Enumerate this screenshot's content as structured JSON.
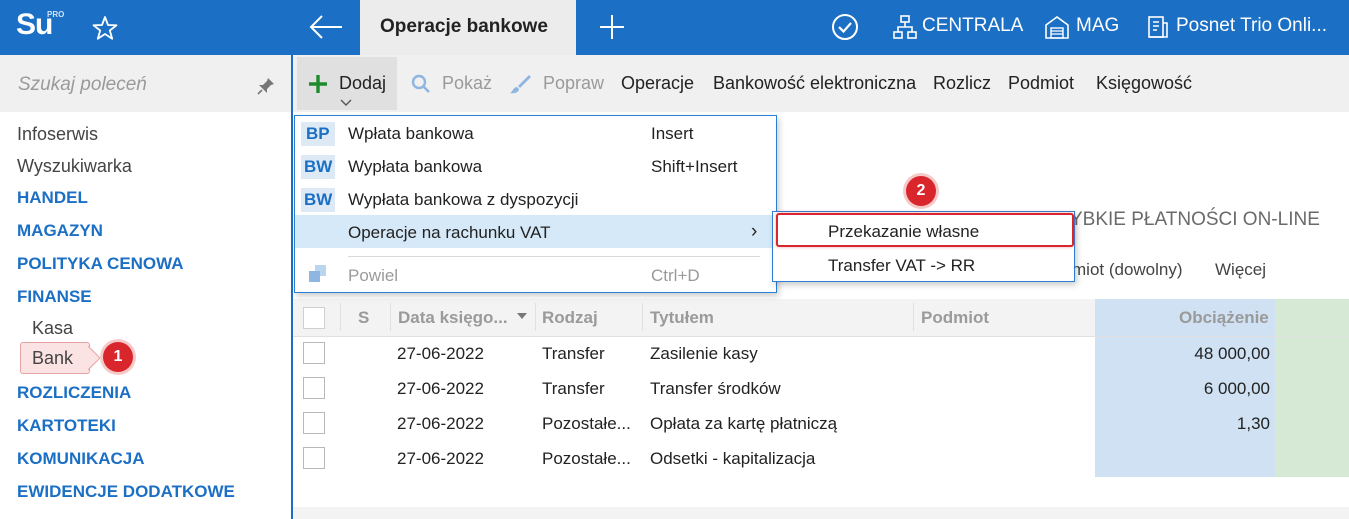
{
  "app": {
    "logo": "Su",
    "logo_badge": "PRO",
    "active_tab": "Operacje bankowe",
    "centrala_label": "CENTRALA",
    "mag_label": "MAG",
    "printer_label": "Posnet Trio Onli..."
  },
  "sidebar": {
    "search_placeholder": "Szukaj poleceń",
    "items": [
      "Infoserwis",
      "Wyszukiwarka"
    ],
    "sections": [
      "HANDEL",
      "MAGAZYN",
      "POLITYKA CENOWA",
      "FINANSE"
    ],
    "sub_items": [
      "Kasa",
      "Bank"
    ],
    "sections_after": [
      "ROZLICZENIA",
      "KARTOTEKI",
      "KOMUNIKACJA",
      "EWIDENCJE DODATKOWE"
    ],
    "badge_1": "1"
  },
  "toolbar": {
    "dodaj": "Dodaj",
    "pokaz": "Pokaż",
    "popraw": "Popraw",
    "operacje": "Operacje",
    "bankowosc": "Bankowość elektroniczna",
    "rozlicz": "Rozlicz",
    "podmiot": "Podmiot",
    "ksiegowosc": "Księgowość"
  },
  "content": {
    "fast_payments": "YBKIE PŁATNOŚCI ON-LINE",
    "filter_podmiot": "miot (dowolny)",
    "filter_more": "Więcej"
  },
  "menu": {
    "items": [
      {
        "code": "BP",
        "label": "Wpłata bankowa",
        "shortcut": "Insert"
      },
      {
        "code": "BW",
        "label": "Wypłata bankowa",
        "shortcut": "Shift+Insert"
      },
      {
        "code": "BW",
        "label": "Wypłata bankowa z dyspozycji",
        "shortcut": ""
      },
      {
        "code": "",
        "label": "Operacje na rachunku VAT",
        "shortcut": "›"
      },
      {
        "code": "",
        "label": "Powiel",
        "shortcut": "Ctrl+D"
      }
    ],
    "badge_2": "2"
  },
  "submenu": {
    "items": [
      "Przekazanie własne",
      "Transfer VAT -> RR"
    ]
  },
  "table": {
    "columns": [
      "S",
      "Data księgo...",
      "Rodzaj",
      "Tytułem",
      "Podmiot",
      "Obciążenie"
    ],
    "rows": [
      {
        "date": "27-06-2022",
        "type": "Transfer",
        "title": "Zasilenie kasy",
        "amount": "48 000,00"
      },
      {
        "date": "27-06-2022",
        "type": "Transfer",
        "title": "Transfer środków",
        "amount": "6 000,00"
      },
      {
        "date": "27-06-2022",
        "type": "Pozostałe...",
        "title": "Opłata za kartę płatniczą",
        "amount": "1,30"
      },
      {
        "date": "27-06-2022",
        "type": "Pozostałe...",
        "title": "Odsetki - kapitalizacja",
        "amount": ""
      }
    ]
  },
  "colors": {
    "brand_blue": "#1b6fc4",
    "highlight_red": "#d9262c"
  }
}
